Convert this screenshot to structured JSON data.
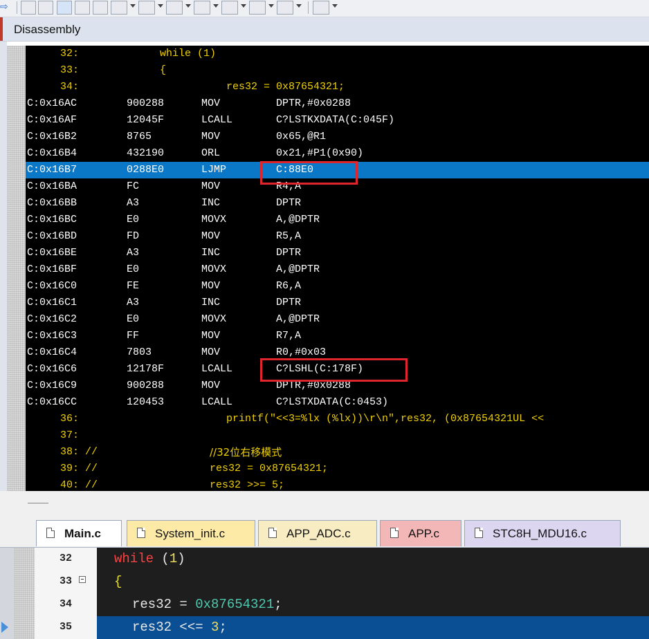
{
  "window": {
    "panel_title": "Disassembly"
  },
  "disassembly": {
    "lines": [
      {
        "kind": "src",
        "num": "32:",
        "text": "while (1)"
      },
      {
        "kind": "src",
        "num": "33:",
        "text": "{"
      },
      {
        "kind": "src",
        "num": "34:",
        "text": "res32 = 0x87654321;"
      },
      {
        "kind": "asm",
        "addr": "C:0x16AC",
        "hex": "900288",
        "op": "MOV",
        "args": "DPTR,#0x0288"
      },
      {
        "kind": "asm",
        "addr": "C:0x16AF",
        "hex": "12045F",
        "op": "LCALL",
        "args": "C?LSTKXDATA(C:045F)"
      },
      {
        "kind": "asm",
        "addr": "C:0x16B2",
        "hex": "8765",
        "op": "MOV",
        "args": "0x65,@R1"
      },
      {
        "kind": "asm",
        "addr": "C:0x16B4",
        "hex": "432190",
        "op": "ORL",
        "args": "0x21,#P1(0x90)"
      },
      {
        "kind": "asm",
        "addr": "C:0x16B7",
        "hex": "0288E0",
        "op": "LJMP",
        "args": "C:88E0",
        "highlight": true
      },
      {
        "kind": "asm",
        "addr": "C:0x16BA",
        "hex": "FC",
        "op": "MOV",
        "args": "R4,A"
      },
      {
        "kind": "asm",
        "addr": "C:0x16BB",
        "hex": "A3",
        "op": "INC",
        "args": "DPTR"
      },
      {
        "kind": "asm",
        "addr": "C:0x16BC",
        "hex": "E0",
        "op": "MOVX",
        "args": "A,@DPTR"
      },
      {
        "kind": "asm",
        "addr": "C:0x16BD",
        "hex": "FD",
        "op": "MOV",
        "args": "R5,A"
      },
      {
        "kind": "asm",
        "addr": "C:0x16BE",
        "hex": "A3",
        "op": "INC",
        "args": "DPTR"
      },
      {
        "kind": "asm",
        "addr": "C:0x16BF",
        "hex": "E0",
        "op": "MOVX",
        "args": "A,@DPTR"
      },
      {
        "kind": "asm",
        "addr": "C:0x16C0",
        "hex": "FE",
        "op": "MOV",
        "args": "R6,A"
      },
      {
        "kind": "asm",
        "addr": "C:0x16C1",
        "hex": "A3",
        "op": "INC",
        "args": "DPTR"
      },
      {
        "kind": "asm",
        "addr": "C:0x16C2",
        "hex": "E0",
        "op": "MOVX",
        "args": "A,@DPTR"
      },
      {
        "kind": "asm",
        "addr": "C:0x16C3",
        "hex": "FF",
        "op": "MOV",
        "args": "R7,A"
      },
      {
        "kind": "asm",
        "addr": "C:0x16C4",
        "hex": "7803",
        "op": "MOV",
        "args": "R0,#0x03"
      },
      {
        "kind": "asm",
        "addr": "C:0x16C6",
        "hex": "12178F",
        "op": "LCALL",
        "args": "C?LSHL(C:178F)"
      },
      {
        "kind": "asm",
        "addr": "C:0x16C9",
        "hex": "900288",
        "op": "MOV",
        "args": "DPTR,#0x0288"
      },
      {
        "kind": "asm",
        "addr": "C:0x16CC",
        "hex": "120453",
        "op": "LCALL",
        "args": "C?LSTXDATA(C:0453)"
      },
      {
        "kind": "src",
        "num": "36:",
        "text": "printf(\"<<3=%lx (%lx))\\r\\n\",res32, (0x87654321UL <<"
      },
      {
        "kind": "src",
        "num": "37:",
        "text": ""
      },
      {
        "kind": "src",
        "num": "38: //",
        "text": "//32位右移模式"
      },
      {
        "kind": "src",
        "num": "39: //",
        "text": "res32 = 0x87654321;"
      },
      {
        "kind": "src",
        "num": "40: //",
        "text": "res32 >>= 5;"
      }
    ]
  },
  "tabs": [
    {
      "label": "Main.c",
      "color": "#ffffff",
      "active": true
    },
    {
      "label": "System_init.c",
      "color": "#fdeaa6"
    },
    {
      "label": "APP_ADC.c",
      "color": "#f8ecc2"
    },
    {
      "label": "APP.c",
      "color": "#f4b7b7"
    },
    {
      "label": "STC8H_MDU16.c",
      "color": "#ddd6f0"
    }
  ],
  "editor": {
    "lines": [
      {
        "num": "32",
        "kw": "while",
        "rest_open": " (",
        "n": "1",
        "rest_close": ")"
      },
      {
        "num": "33",
        "brace": "{"
      },
      {
        "num": "34",
        "id": "res32 = ",
        "hex": "0x87654321",
        "end": ";"
      },
      {
        "num": "35",
        "id": "res32 <<= ",
        "n": "3",
        "end": ";",
        "current": true
      }
    ]
  }
}
